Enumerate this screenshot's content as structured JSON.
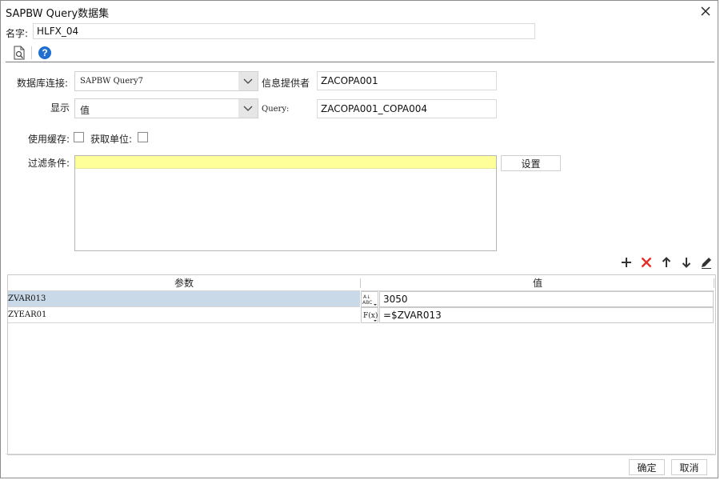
{
  "window": {
    "title": "SAPBW Query数据集"
  },
  "name_row": {
    "label": "名字:",
    "value": "HLFX_04"
  },
  "toolbar": {
    "icons": [
      "preview-icon",
      "help-icon"
    ]
  },
  "form": {
    "db_connection_label": "数据库连接:",
    "db_connection_value": "SAPBW Query7",
    "info_provider_label": "信息提供者",
    "info_provider_value": "ZACOPA001",
    "display_label": "显示",
    "display_value": "值",
    "query_label": "Query:",
    "query_value": "ZACOPA001_COPA004",
    "use_cache_label": "使用缓存:",
    "use_cache_checked": false,
    "get_unit_label": "获取单位:",
    "get_unit_checked": false,
    "filter_label": "过滤条件:",
    "settings_button": "设置"
  },
  "params_toolbar": {
    "icons": [
      "add-icon",
      "delete-icon",
      "move-up-icon",
      "move-down-icon",
      "edit-icon"
    ],
    "colors": {
      "add": "#333333",
      "delete": "#e0302e"
    }
  },
  "params_table": {
    "columns": [
      "参数",
      "值"
    ],
    "rows": [
      {
        "name": "ZVAR013",
        "type_icon": "text-type-icon",
        "value": "3050",
        "selected": true
      },
      {
        "name": "ZYEAR01",
        "type_icon": "formula-type-icon",
        "value": "=$ZVAR013",
        "selected": false
      }
    ],
    "type_icon_text": {
      "text": "ABC",
      "formula": "F(x)"
    }
  },
  "footer": {
    "ok_label": "确定",
    "cancel_label": "取消"
  },
  "colors": {
    "selected_row": "#c9d9e7",
    "filter_row": "#ffff99",
    "help_icon": "#1e6fd0"
  }
}
